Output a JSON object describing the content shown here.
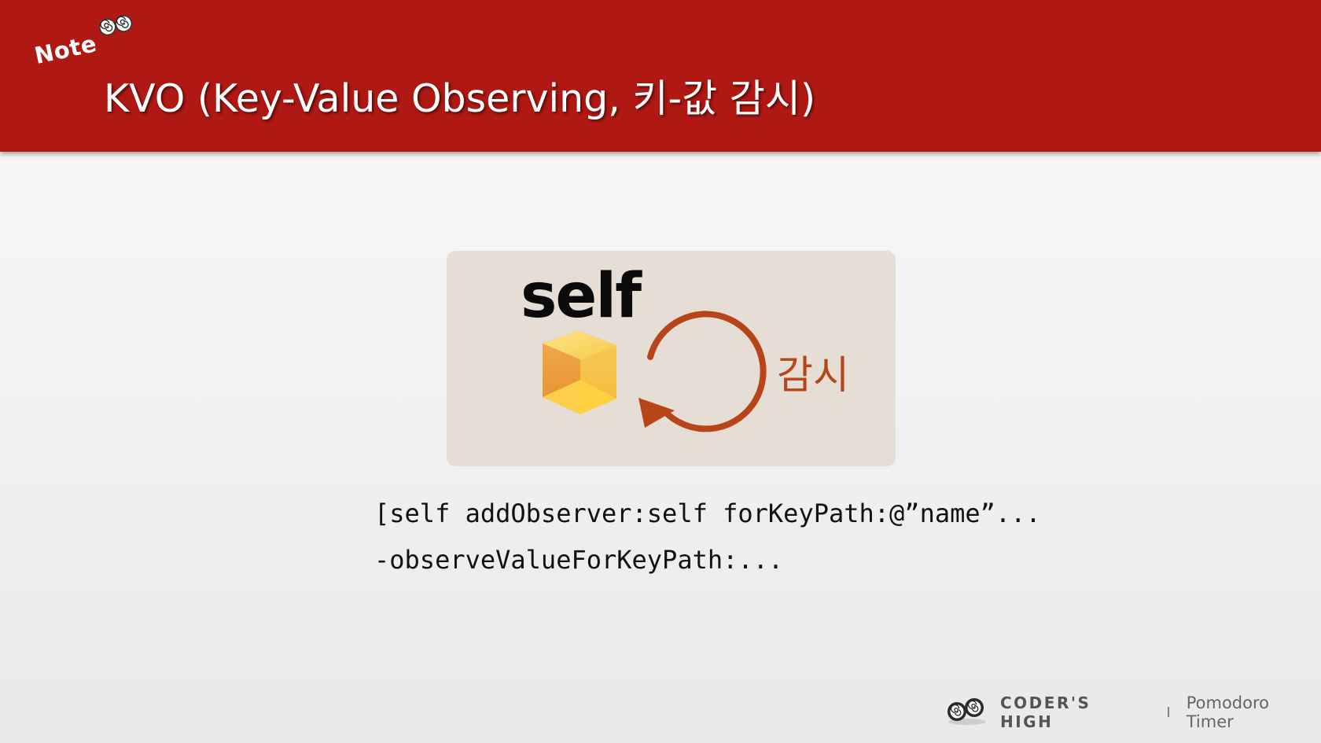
{
  "header": {
    "badge": "Note",
    "title": "KVO (Key-Value Observing, 키-값 감시)"
  },
  "diagram": {
    "object_label": "self",
    "observe_label": "감시",
    "accent_color": "#b8451a"
  },
  "code_lines": [
    "[self addObserver:self forKeyPath:@”name”...",
    "-observeValueForKeyPath:..."
  ],
  "footer": {
    "brand": "CODER'S HIGH",
    "separator": "I",
    "app_name": "Pomodoro Timer"
  },
  "colors": {
    "header_bg": "#b01813",
    "diagram_bg": "#e6ded5"
  },
  "icons": [
    "spiral-eyes-icon",
    "cube-icon",
    "observe-arrow-icon",
    "coders-high-logo"
  ]
}
